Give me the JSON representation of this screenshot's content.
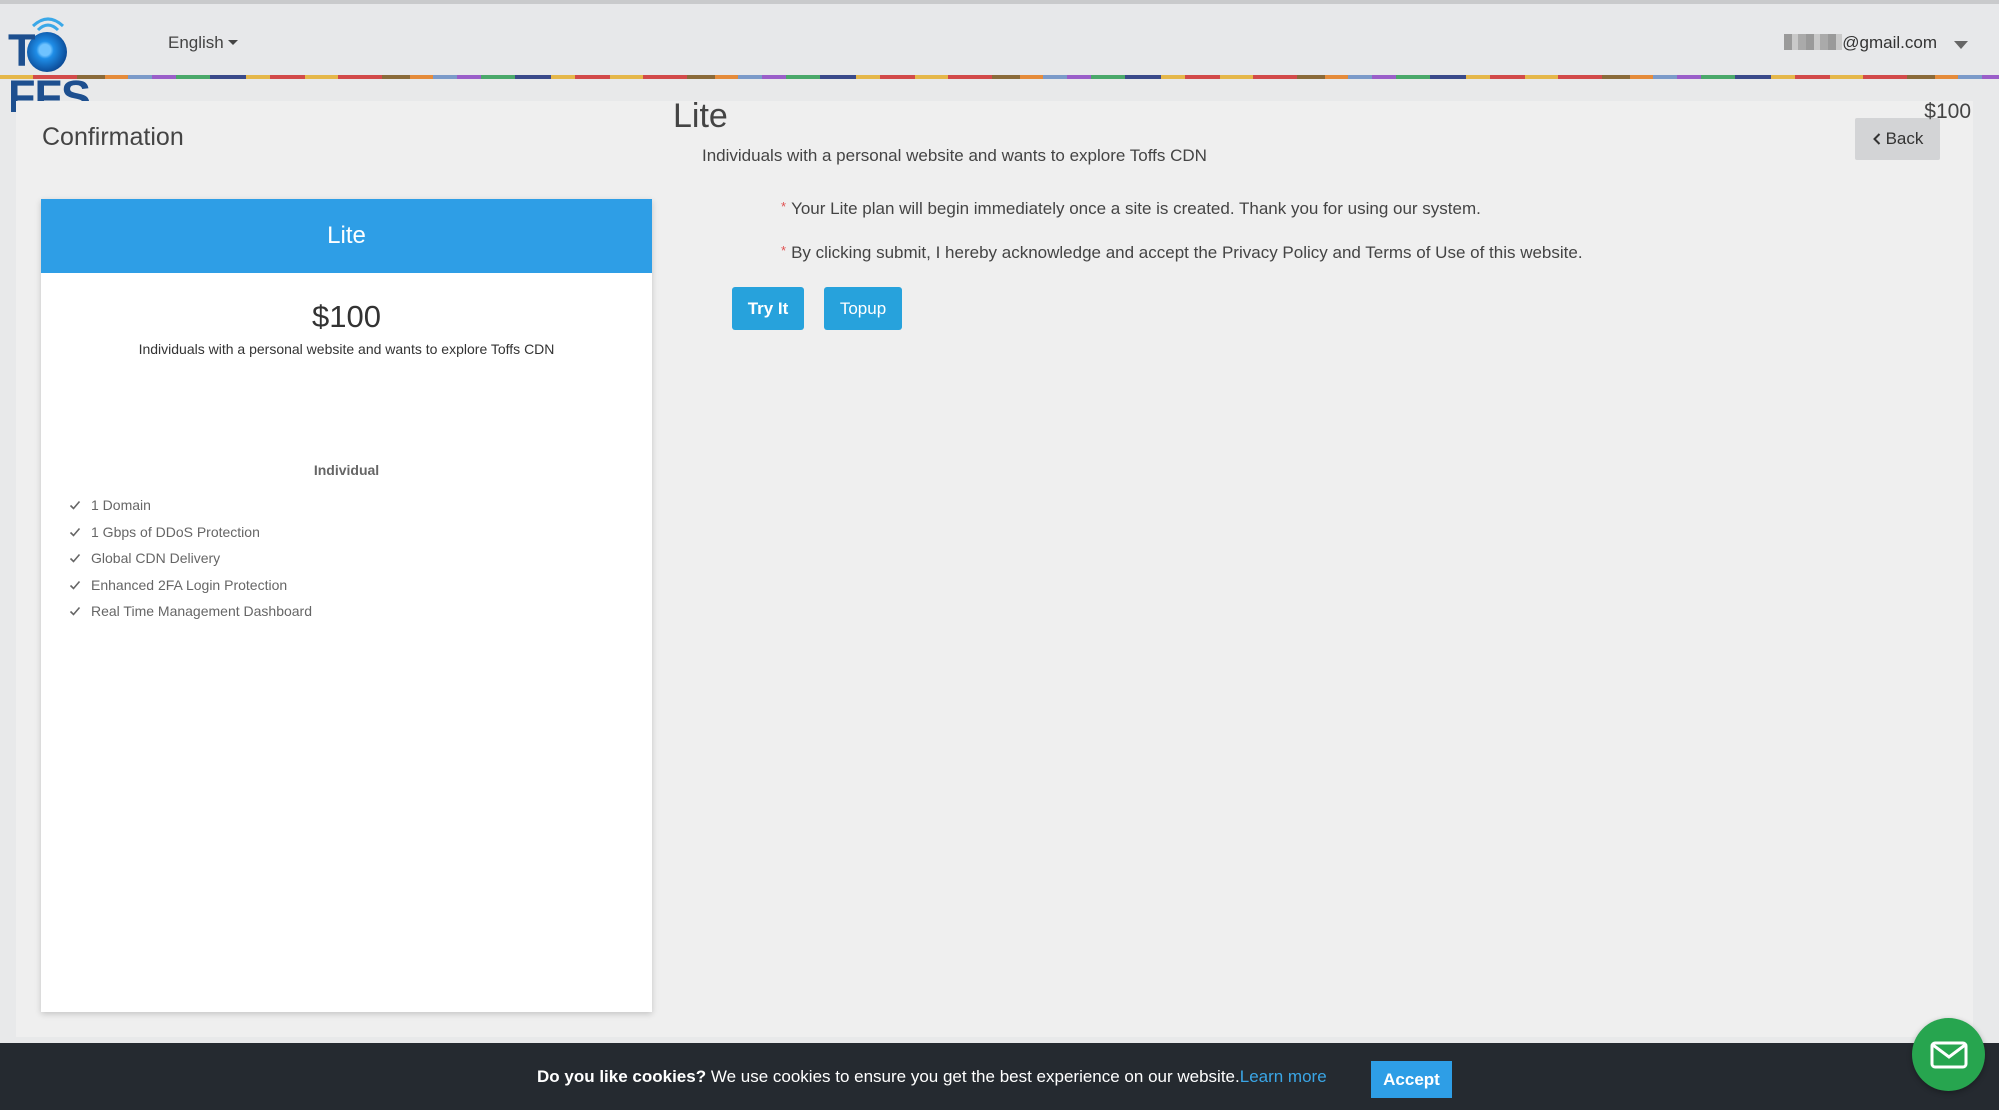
{
  "header": {
    "logo_text": "TOFFS",
    "language": "English",
    "user_email": "@gmail.com"
  },
  "page": {
    "title": "Confirmation",
    "back_label": "Back"
  },
  "plan_card": {
    "name": "Lite",
    "price": "$100",
    "description": "Individuals with a personal website and wants to explore Toffs CDN",
    "section_title": "Individual",
    "features": [
      "1 Domain",
      "1 Gbps of DDoS Protection",
      "Global CDN Delivery",
      "Enhanced 2FA Login Protection",
      "Real Time Management Dashboard"
    ]
  },
  "detail": {
    "name": "Lite",
    "price": "$100",
    "description": "Individuals with a personal website and wants to explore Toffs CDN",
    "notes": [
      "Your Lite plan will begin immediately once a site is created. Thank you for using our system.",
      "By clicking submit, I hereby acknowledge and accept the Privacy Policy and Terms of Use of this website."
    ],
    "try_label": "Try It",
    "topup_label": "Topup"
  },
  "cookie": {
    "question": "Do you like cookies?",
    "message": " We use cookies to ensure you get the best experience on our website.",
    "link": "Learn more",
    "accept_label": "Accept"
  },
  "colors": {
    "primary": "#2e9ee6",
    "button": "#27a2dc",
    "cookie_bg": "#252a30",
    "fab": "#27a54f"
  }
}
